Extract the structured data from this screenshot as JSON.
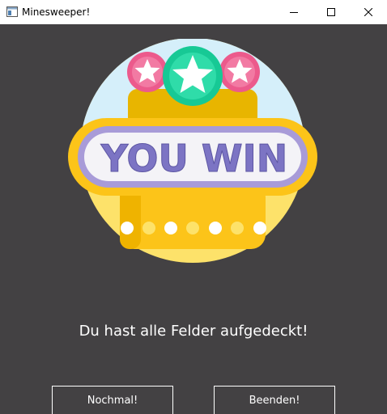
{
  "window": {
    "title": "Minesweeper!",
    "controls": {
      "minimize_icon": "minimize-icon",
      "maximize_icon": "maximize-icon",
      "close_icon": "close-icon"
    }
  },
  "banner": {
    "text": "YOU WIN",
    "stars": 3,
    "colors": {
      "sky": "#d5effa",
      "gold": "#fcc419",
      "sign": "#f4f3f7",
      "text": "#7c74c4",
      "star_pink": "#ec5a8c",
      "star_green": "#17c995"
    }
  },
  "message": "Du hast alle Felder aufgedeckt!",
  "buttons": {
    "again": "Nochmal!",
    "quit": "Beenden!"
  },
  "colors": {
    "background": "#434143",
    "button_border": "#ffffff"
  }
}
